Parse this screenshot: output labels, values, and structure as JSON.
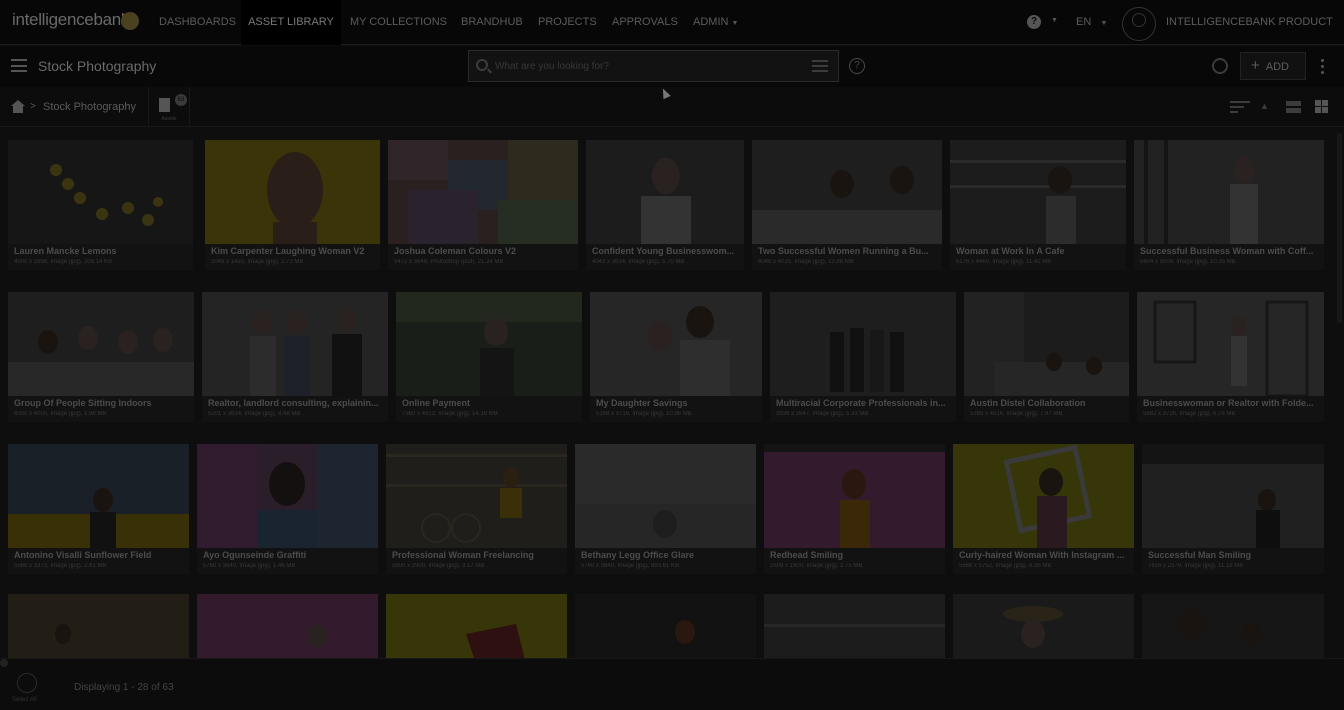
{
  "topnav": {
    "logo_text": "intelligencebank",
    "items": [
      {
        "label": "DASHBOARDS",
        "active": false
      },
      {
        "label": "ASSET LIBRARY",
        "active": true
      },
      {
        "label": "MY COLLECTIONS",
        "active": false
      },
      {
        "label": "BRANDHUB",
        "active": false
      },
      {
        "label": "PROJECTS",
        "active": false
      },
      {
        "label": "APPROVALS",
        "active": false
      },
      {
        "label": "ADMIN",
        "active": false
      }
    ],
    "help_icon": "question-circle-icon",
    "language": "EN",
    "user": "INTELLIGENCEBANK PRODUCT"
  },
  "subbar": {
    "title": "Stock Photography",
    "search_placeholder": "What are you looking for?",
    "add_label": "ADD"
  },
  "breadcrumb": {
    "home_icon": "home-icon",
    "separator": ">",
    "current": "Stock Photography",
    "assets_count": "63",
    "assets_label": "Assets"
  },
  "tiles": [
    {
      "title": "Lauren Mancke Lemons",
      "meta": "4000 x 2668, Image (jpg), 206.14 KB"
    },
    {
      "title": "Kim Carpenter Laughing Woman V2",
      "meta": "2048 x 1492, Image (jpg), 2.73 MB"
    },
    {
      "title": "Joshua Coleman Colours V2",
      "meta": "5472 x 3648, Photoshop (psd), 21.24 MB"
    },
    {
      "title": "Confident Young Businesswom...",
      "meta": "4043 x 3634, Image (jpg), 5.70 MB"
    },
    {
      "title": "Two Successful Women Running a Bu...",
      "meta": "6048 x 4025, Image (jpg), 13.88 MB"
    },
    {
      "title": "Woman at Work In A Cafe",
      "meta": "6176 x 4460, Image (jpg), 11.41 MB"
    },
    {
      "title": "Successful Business Woman with Coff...",
      "meta": "5804 x 5008, Image (jpg), 10.35 MB"
    },
    {
      "title": "Group Of People Sitting Indoors",
      "meta": "6000 x 4000, Image (jpg), 1.98 MB"
    },
    {
      "title": "Realtor, landlord consulting, explainin...",
      "meta": "5201 x 3634, Image (jpg), 8.48 MB"
    },
    {
      "title": "Online Payment",
      "meta": "7360 x 4912, Image (jpg), 14.18 MB"
    },
    {
      "title": "My Daughter Savings",
      "meta": "5168 x 3716, Image (jpg), 10.96 MB"
    },
    {
      "title": "Multiracial Corporate Professionals in...",
      "meta": "3936 x 2647, Image (jpg), 5.33 MB"
    },
    {
      "title": "Austin Distel Collaboration",
      "meta": "5395 x 4016, Image (jpg), 7.87 MB"
    },
    {
      "title": "Businesswoman or Realtor with Folde...",
      "meta": "5682 x 3726, Image (jpg), 6.79 MB"
    },
    {
      "title": "Antonino Visalli Sunflower Field",
      "meta": "5568 x 3373, Image (jpg), 2.61 MB"
    },
    {
      "title": "Ayo Ogunseinde Graffiti",
      "meta": "5760 x 3840, Image (jpg), 1.46 MB"
    },
    {
      "title": "Professional Woman Freelancing",
      "meta": "5800 x 2900, Image (jpg), 3.17 MB"
    },
    {
      "title": "Bethany Legg Office Glare",
      "meta": "5760 x 3840, Image (jpg), 893.61 KB"
    },
    {
      "title": "Redhead Smiling",
      "meta": "2509 x 1900, Image (jpg), 2.75 MB"
    },
    {
      "title": "Curly-haired Woman With Instagram ...",
      "meta": "5568 x 5752, Image (jpg), 8.36 MB"
    },
    {
      "title": "Successful Man Smiling",
      "meta": "7816 x 2376, Image (jpg), 11.18 MB"
    }
  ],
  "footer": {
    "select_all": "Select All",
    "display_text": "Displaying 1 - 28 of 63"
  }
}
